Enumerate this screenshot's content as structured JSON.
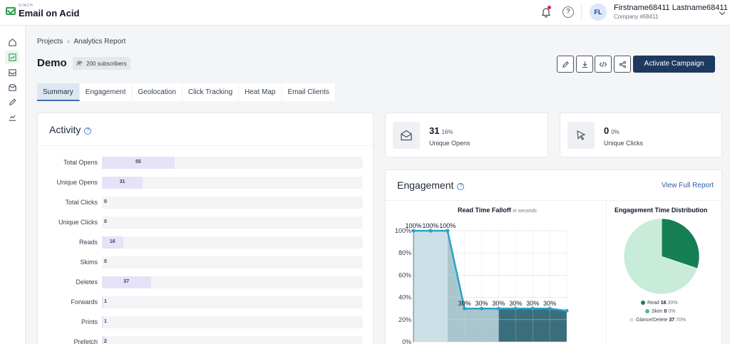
{
  "app": {
    "logo_small": "SINCH",
    "logo_name": "Email on Acid"
  },
  "user": {
    "initials": "FL",
    "name": "Firstname68411 Lastname68411",
    "company": "Company #68411"
  },
  "breadcrumb": [
    "Projects",
    "Analytics Report"
  ],
  "campaign": {
    "title": "Demo",
    "subscribers": "200 subscribers",
    "activate_label": "Activate Campaign"
  },
  "toolbar_icons": [
    "pencil-icon",
    "download-icon",
    "code-icon",
    "share-icon"
  ],
  "tabs": [
    {
      "label": "Summary",
      "active": true
    },
    {
      "label": "Engagement",
      "active": false
    },
    {
      "label": "Geolocation",
      "active": false
    },
    {
      "label": "Click Tracking",
      "active": false
    },
    {
      "label": "Heat Map",
      "active": false
    },
    {
      "label": "Email Clients",
      "active": false
    }
  ],
  "activity": {
    "title": "Activity",
    "rows": [
      {
        "label": "Total Opens",
        "value": 55
      },
      {
        "label": "Unique Opens",
        "value": 31
      },
      {
        "label": "Total Clicks",
        "value": 0
      },
      {
        "label": "Unique Clicks",
        "value": 0
      },
      {
        "label": "Reads",
        "value": 16
      },
      {
        "label": "Skims",
        "value": 0
      },
      {
        "label": "Deletes",
        "value": 37
      },
      {
        "label": "Forwards",
        "value": 1
      },
      {
        "label": "Prints",
        "value": 1
      },
      {
        "label": "Prefetch",
        "value": 2
      }
    ]
  },
  "stats": {
    "opens": {
      "value": "31",
      "pct": "16%",
      "label": "Unique Opens"
    },
    "clicks": {
      "value": "0",
      "pct": "0%",
      "label": "Unique Clicks"
    }
  },
  "engagement": {
    "title": "Engagement",
    "view_full_label": "View Full Report"
  },
  "chart_data": [
    {
      "type": "area",
      "title": "Read Time Falloff",
      "subtitle": "in seconds",
      "y_ticks": [
        "0%",
        "20%",
        "40%",
        "60%",
        "80%",
        "100%"
      ],
      "ylim": [
        0,
        100
      ],
      "grid": true,
      "values": [
        100,
        100,
        100,
        30,
        30,
        30,
        30,
        30,
        30,
        28
      ],
      "data_labels": [
        "100%",
        "100%",
        "100%",
        "30%",
        "30%",
        "30%",
        "30%",
        "30%",
        "30%",
        ""
      ],
      "zones": [
        {
          "name": "Glance",
          "color": "#cce0e7"
        },
        {
          "name": "Skim",
          "color": "#a9c6cf"
        },
        {
          "name": "Read",
          "color": "#3b6e7c"
        }
      ],
      "line_color": "#2aa3c7"
    },
    {
      "type": "pie",
      "title": "Engagement Time Distribution",
      "legend": "bottom",
      "slices": [
        {
          "name": "Read",
          "value": 16,
          "pct": "30%",
          "color": "#157f53"
        },
        {
          "name": "Skim",
          "value": 0,
          "pct": "0%",
          "color": "#4fbb88"
        },
        {
          "name": "Glance/Delete",
          "value": 37,
          "pct": "70%",
          "color": "#c8ecd9"
        }
      ]
    }
  ]
}
